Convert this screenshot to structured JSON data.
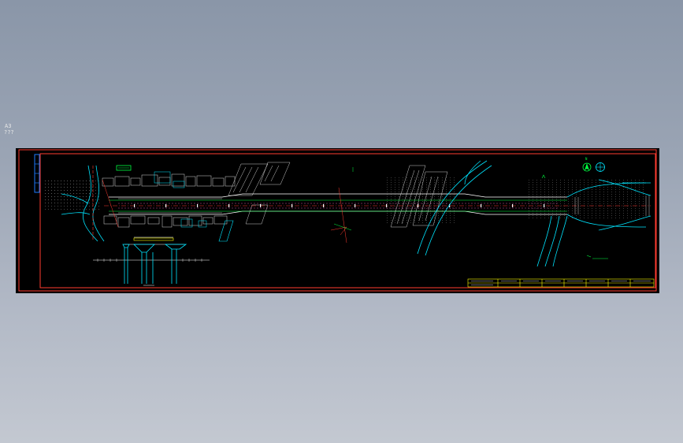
{
  "window": {
    "title": ""
  },
  "sheet": {
    "size_label": "A3",
    "note": "???"
  },
  "drawing": {
    "compass_letter": "N",
    "plan_label": "",
    "section_label": "",
    "title_block": {
      "cells": [
        "",
        "",
        "",
        "",
        "",
        "",
        "",
        ""
      ]
    }
  },
  "colors": {
    "background": "#000000",
    "frame": "#ff3b30",
    "road": "#ffffff",
    "centerline": "#ff3b30",
    "buildings": "#ffffff",
    "ramps": "#00e5ff",
    "vegetation": "#00ff40",
    "title_block": "#ffff00",
    "section_piers": "#00e5ff"
  },
  "icons": [
    "north-arrow-icon",
    "compass-circle-icon"
  ]
}
